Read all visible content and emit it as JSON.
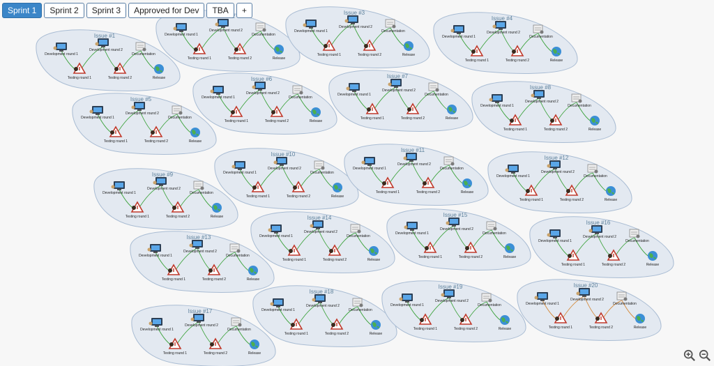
{
  "tabs": [
    {
      "label": "Sprint 1",
      "active": true
    },
    {
      "label": "Sprint 2",
      "active": false
    },
    {
      "label": "Sprint 3",
      "active": false
    },
    {
      "label": "Approved for Dev",
      "active": false
    },
    {
      "label": "TBA",
      "active": false
    },
    {
      "label": "+",
      "active": false
    }
  ],
  "node_labels": {
    "dev1": "Development round 1",
    "dev2": "Development round 2",
    "doc": "Documentation",
    "test1": "Testing round 1",
    "test2": "Testing round 2",
    "release": "Release"
  },
  "issues": [
    {
      "title": "Issue #1"
    },
    {
      "title": "Issue #2"
    },
    {
      "title": "Issue #3"
    },
    {
      "title": "Issue #4"
    },
    {
      "title": "Issue #5"
    },
    {
      "title": "Issue #6"
    },
    {
      "title": "Issue #7"
    },
    {
      "title": "Issue #8"
    },
    {
      "title": "Issue #9"
    },
    {
      "title": "Issue #10"
    },
    {
      "title": "Issue #11"
    },
    {
      "title": "Issue #12"
    },
    {
      "title": "Issue #13"
    },
    {
      "title": "Issue #14"
    },
    {
      "title": "Issue #15"
    },
    {
      "title": "Issue #16"
    },
    {
      "title": "Issue #17"
    },
    {
      "title": "Issue #18"
    },
    {
      "title": "Issue #19"
    },
    {
      "title": "Issue #20"
    }
  ],
  "colors": {
    "cluster_fill": "#e3e9f1",
    "cluster_stroke": "#a9bcd3",
    "title": "#5b7f9a",
    "edge": "#3da33d",
    "edge_alt": "#d58a3a",
    "active_tab": "#3b86c8"
  },
  "zoom": {
    "in_icon": "zoom-in-icon",
    "out_icon": "zoom-out-icon"
  }
}
